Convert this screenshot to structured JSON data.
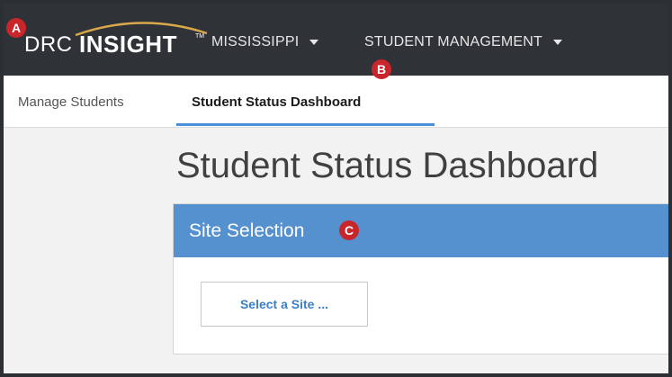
{
  "navbar": {
    "logo": {
      "drc": "DRC",
      "insight": "INSIGHT",
      "tm": "TM"
    },
    "items": [
      {
        "label": "MISSISSIPPI"
      },
      {
        "label": "STUDENT MANAGEMENT"
      }
    ]
  },
  "subnav": {
    "tabs": [
      {
        "label": "Manage Students",
        "active": false
      },
      {
        "label": "Student Status Dashboard",
        "active": true
      }
    ]
  },
  "main": {
    "title": "Student Status Dashboard",
    "panel": {
      "title": "Site Selection",
      "button_label": "Select a Site ..."
    }
  },
  "markers": {
    "a": "A",
    "b": "B",
    "c": "C"
  },
  "colors": {
    "navbar_bg": "#2f3338",
    "accent": "#5591cf",
    "tab_underline": "#4a90d9",
    "button_text": "#3a7fc8",
    "marker": "#c8262b"
  },
  "icons": {
    "caret": "chevron-down-icon"
  }
}
